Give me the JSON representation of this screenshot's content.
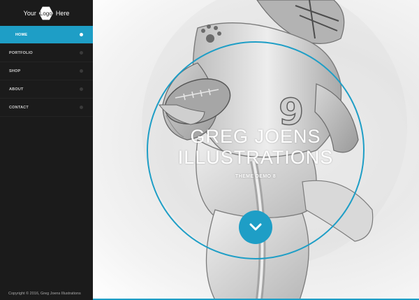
{
  "logo": {
    "left": "Your",
    "center": "Logo",
    "right": "Here"
  },
  "nav": {
    "items": [
      {
        "label": "HOME",
        "active": true
      },
      {
        "label": "PORTFOLIO",
        "active": false
      },
      {
        "label": "SHOP",
        "active": false
      },
      {
        "label": "ABOUT",
        "active": false
      },
      {
        "label": "CONTACT",
        "active": false
      }
    ]
  },
  "footer": {
    "copyright": "Copyright © 2016, Greg Joens Illustrations"
  },
  "hero": {
    "title_line1": "GREG JOENS",
    "title_line2": "ILLUSTRATIONS",
    "subtitle": "THEME DEMO 8",
    "jersey_number": "9",
    "scroll_icon": "chevron-down-icon"
  },
  "colors": {
    "accent": "#1e9ec6",
    "sidebar": "#1b1b1b"
  }
}
